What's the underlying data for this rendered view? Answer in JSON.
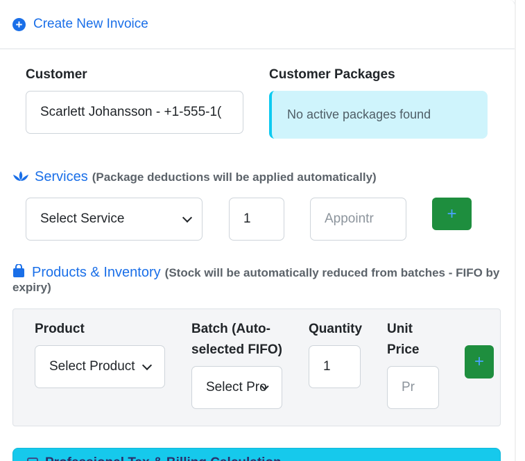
{
  "header": {
    "title": "Create New Invoice",
    "icon": "plus-circle-icon"
  },
  "customer": {
    "label": "Customer",
    "value": "Scarlett Johansson - +1-555-1("
  },
  "packages": {
    "label": "Customer Packages",
    "message": "No active packages found"
  },
  "services": {
    "title": "Services",
    "note": "(Package deductions will be applied automatically)",
    "select_value": "Select Service",
    "quantity": "1",
    "appointment_placeholder": "Appointr",
    "add_label": "+"
  },
  "products": {
    "title": "Products & Inventory",
    "note_line1": "(Stock will be automatically reduced from batches - FIFO by",
    "note_line2": "expiry)",
    "columns": {
      "product": "Product",
      "batch_line1": "Batch (Auto-",
      "batch_line2": "selected FIFO)",
      "quantity": "Quantity",
      "price_line1": "Unit",
      "price_line2": "Price"
    },
    "product_select": "Select Product",
    "batch_select": "Select Pro",
    "quantity": "1",
    "price_placeholder": "Pr",
    "add_label": "+"
  },
  "billing": {
    "title": "Professional Tax & Billing Calculation"
  },
  "colors": {
    "primary": "#1a6fe8",
    "success": "#1e8e3e",
    "info_bg": "#cff4fc",
    "info_border": "#0dcaf0",
    "billing_bg": "#16c9ec"
  }
}
